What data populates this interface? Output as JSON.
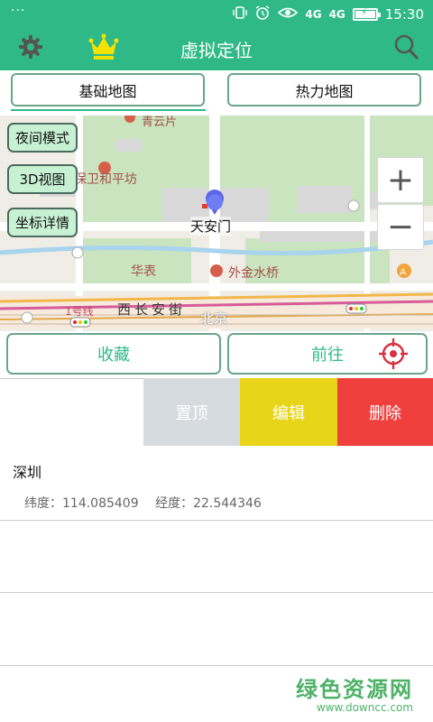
{
  "status_bar": {
    "menu_dots": "···",
    "network": "4G",
    "network2": "4G",
    "time": "15:30",
    "icons": [
      "vibrate-icon",
      "alarm-icon",
      "eye-icon",
      "signal-icon",
      "battery-charging-icon"
    ]
  },
  "app_bar": {
    "title": "虚拟定位",
    "icons": [
      "gear-icon",
      "crown-icon",
      "search-icon"
    ],
    "color": "#2fb989"
  },
  "map_tabs": {
    "basic": "基础地图",
    "heat": "热力地图",
    "selected": "基础地图"
  },
  "map": {
    "buttons": {
      "night_mode": "夜间模式",
      "view_3d": "3D视图",
      "coord_detail": "坐标详情"
    },
    "zoom": {
      "in": "+",
      "out": "−"
    },
    "labels": {
      "marker": "天安门",
      "top_poi": "青云片",
      "poi1": "保卫和平坊",
      "poi2": "华表",
      "poi3": "外金水桥",
      "street": "西长安街",
      "line": "1号线",
      "city": "北京"
    },
    "badge": "A"
  },
  "actions": {
    "favorite": "收藏",
    "goto": "前往",
    "locate_icon": "crosshair-icon"
  },
  "swipe_actions": [
    {
      "label": "置顶",
      "color": "#d6dbe0"
    },
    {
      "label": "编辑",
      "color": "#e8d51a"
    },
    {
      "label": "删除",
      "color": "#f0403e"
    }
  ],
  "locations": [
    {
      "name": "深圳",
      "lat_label": "纬度：",
      "lat": "114.085409",
      "lng_label": "经度：",
      "lng": "22.544346"
    }
  ],
  "watermark": {
    "main": "绿色资源网",
    "url": "www.downcc.com"
  }
}
